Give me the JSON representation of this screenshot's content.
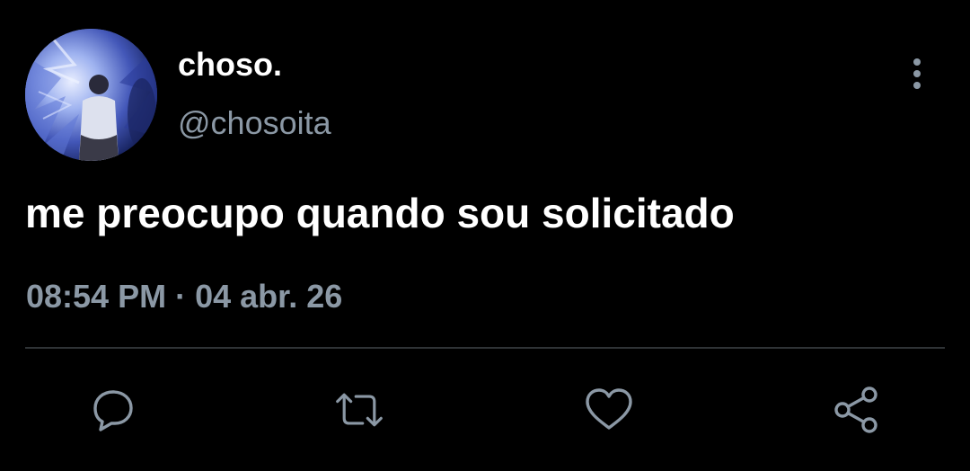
{
  "tweet": {
    "display_name": "choso.",
    "handle": "@chosoita",
    "text": "me preocupo quando sou solicitado",
    "time": "08:54 PM",
    "separator": "·",
    "date": "04 abr. 26"
  },
  "icons": {
    "more": "more-vertical-icon",
    "reply": "reply-icon",
    "retweet": "retweet-icon",
    "like": "heart-icon",
    "share": "share-icon"
  },
  "colors": {
    "background": "#000000",
    "primary_text": "#ffffff",
    "secondary_text": "#8b98a5",
    "divider": "#2f3336"
  }
}
